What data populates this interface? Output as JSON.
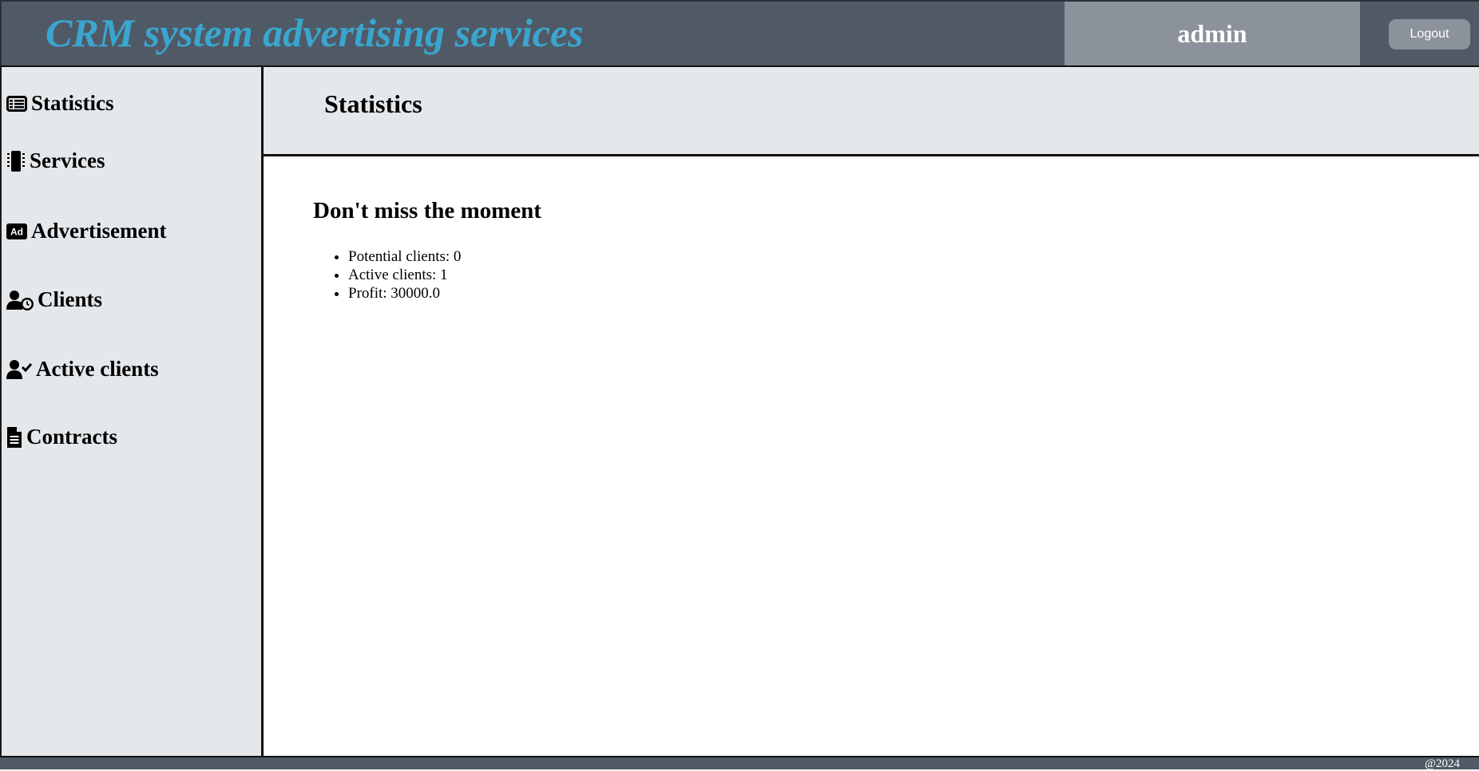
{
  "header": {
    "app_title": "CRM system advertising services",
    "username": "admin",
    "logout_label": "Logout"
  },
  "sidebar": {
    "items": [
      {
        "label": "Statistics",
        "icon": "table-list-icon"
      },
      {
        "label": "Services",
        "icon": "sim-card-icon"
      },
      {
        "label": "Advertisement",
        "icon": "ad-icon"
      },
      {
        "label": "Clients",
        "icon": "user-clock-icon"
      },
      {
        "label": "Active clients",
        "icon": "user-check-icon"
      },
      {
        "label": "Contracts",
        "icon": "file-lines-icon"
      }
    ]
  },
  "main": {
    "page_title": "Statistics",
    "section_title": "Don't miss the moment",
    "stats": [
      "Potential clients: 0",
      "Active clients: 1",
      "Profit: 30000.0"
    ]
  },
  "footer": {
    "text": "@2024"
  },
  "colors": {
    "topbar": "#505a66",
    "title_accent": "#3aa6cf",
    "user_box": "#8b929b",
    "panel_bg": "#e4e8eb"
  }
}
